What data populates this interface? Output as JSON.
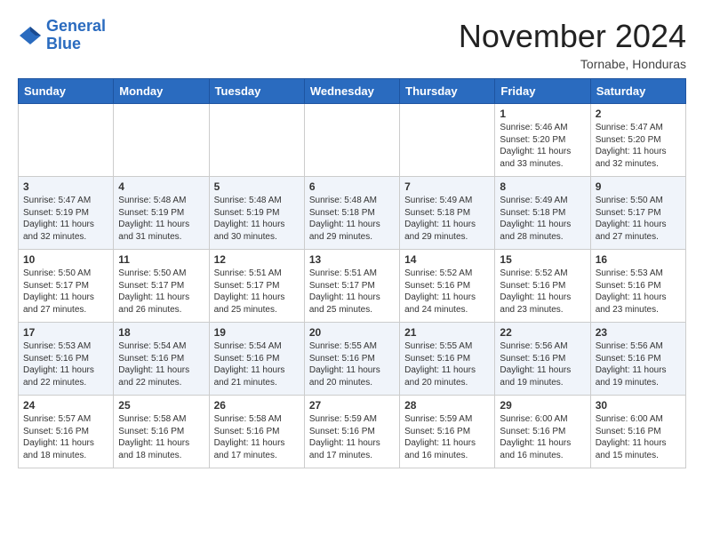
{
  "header": {
    "logo_line1": "General",
    "logo_line2": "Blue",
    "month_title": "November 2024",
    "location": "Tornabe, Honduras"
  },
  "weekdays": [
    "Sunday",
    "Monday",
    "Tuesday",
    "Wednesday",
    "Thursday",
    "Friday",
    "Saturday"
  ],
  "weeks": [
    [
      {
        "day": "",
        "info": ""
      },
      {
        "day": "",
        "info": ""
      },
      {
        "day": "",
        "info": ""
      },
      {
        "day": "",
        "info": ""
      },
      {
        "day": "",
        "info": ""
      },
      {
        "day": "1",
        "info": "Sunrise: 5:46 AM\nSunset: 5:20 PM\nDaylight: 11 hours\nand 33 minutes."
      },
      {
        "day": "2",
        "info": "Sunrise: 5:47 AM\nSunset: 5:20 PM\nDaylight: 11 hours\nand 32 minutes."
      }
    ],
    [
      {
        "day": "3",
        "info": "Sunrise: 5:47 AM\nSunset: 5:19 PM\nDaylight: 11 hours\nand 32 minutes."
      },
      {
        "day": "4",
        "info": "Sunrise: 5:48 AM\nSunset: 5:19 PM\nDaylight: 11 hours\nand 31 minutes."
      },
      {
        "day": "5",
        "info": "Sunrise: 5:48 AM\nSunset: 5:19 PM\nDaylight: 11 hours\nand 30 minutes."
      },
      {
        "day": "6",
        "info": "Sunrise: 5:48 AM\nSunset: 5:18 PM\nDaylight: 11 hours\nand 29 minutes."
      },
      {
        "day": "7",
        "info": "Sunrise: 5:49 AM\nSunset: 5:18 PM\nDaylight: 11 hours\nand 29 minutes."
      },
      {
        "day": "8",
        "info": "Sunrise: 5:49 AM\nSunset: 5:18 PM\nDaylight: 11 hours\nand 28 minutes."
      },
      {
        "day": "9",
        "info": "Sunrise: 5:50 AM\nSunset: 5:17 PM\nDaylight: 11 hours\nand 27 minutes."
      }
    ],
    [
      {
        "day": "10",
        "info": "Sunrise: 5:50 AM\nSunset: 5:17 PM\nDaylight: 11 hours\nand 27 minutes."
      },
      {
        "day": "11",
        "info": "Sunrise: 5:50 AM\nSunset: 5:17 PM\nDaylight: 11 hours\nand 26 minutes."
      },
      {
        "day": "12",
        "info": "Sunrise: 5:51 AM\nSunset: 5:17 PM\nDaylight: 11 hours\nand 25 minutes."
      },
      {
        "day": "13",
        "info": "Sunrise: 5:51 AM\nSunset: 5:17 PM\nDaylight: 11 hours\nand 25 minutes."
      },
      {
        "day": "14",
        "info": "Sunrise: 5:52 AM\nSunset: 5:16 PM\nDaylight: 11 hours\nand 24 minutes."
      },
      {
        "day": "15",
        "info": "Sunrise: 5:52 AM\nSunset: 5:16 PM\nDaylight: 11 hours\nand 23 minutes."
      },
      {
        "day": "16",
        "info": "Sunrise: 5:53 AM\nSunset: 5:16 PM\nDaylight: 11 hours\nand 23 minutes."
      }
    ],
    [
      {
        "day": "17",
        "info": "Sunrise: 5:53 AM\nSunset: 5:16 PM\nDaylight: 11 hours\nand 22 minutes."
      },
      {
        "day": "18",
        "info": "Sunrise: 5:54 AM\nSunset: 5:16 PM\nDaylight: 11 hours\nand 22 minutes."
      },
      {
        "day": "19",
        "info": "Sunrise: 5:54 AM\nSunset: 5:16 PM\nDaylight: 11 hours\nand 21 minutes."
      },
      {
        "day": "20",
        "info": "Sunrise: 5:55 AM\nSunset: 5:16 PM\nDaylight: 11 hours\nand 20 minutes."
      },
      {
        "day": "21",
        "info": "Sunrise: 5:55 AM\nSunset: 5:16 PM\nDaylight: 11 hours\nand 20 minutes."
      },
      {
        "day": "22",
        "info": "Sunrise: 5:56 AM\nSunset: 5:16 PM\nDaylight: 11 hours\nand 19 minutes."
      },
      {
        "day": "23",
        "info": "Sunrise: 5:56 AM\nSunset: 5:16 PM\nDaylight: 11 hours\nand 19 minutes."
      }
    ],
    [
      {
        "day": "24",
        "info": "Sunrise: 5:57 AM\nSunset: 5:16 PM\nDaylight: 11 hours\nand 18 minutes."
      },
      {
        "day": "25",
        "info": "Sunrise: 5:58 AM\nSunset: 5:16 PM\nDaylight: 11 hours\nand 18 minutes."
      },
      {
        "day": "26",
        "info": "Sunrise: 5:58 AM\nSunset: 5:16 PM\nDaylight: 11 hours\nand 17 minutes."
      },
      {
        "day": "27",
        "info": "Sunrise: 5:59 AM\nSunset: 5:16 PM\nDaylight: 11 hours\nand 17 minutes."
      },
      {
        "day": "28",
        "info": "Sunrise: 5:59 AM\nSunset: 5:16 PM\nDaylight: 11 hours\nand 16 minutes."
      },
      {
        "day": "29",
        "info": "Sunrise: 6:00 AM\nSunset: 5:16 PM\nDaylight: 11 hours\nand 16 minutes."
      },
      {
        "day": "30",
        "info": "Sunrise: 6:00 AM\nSunset: 5:16 PM\nDaylight: 11 hours\nand 15 minutes."
      }
    ]
  ]
}
